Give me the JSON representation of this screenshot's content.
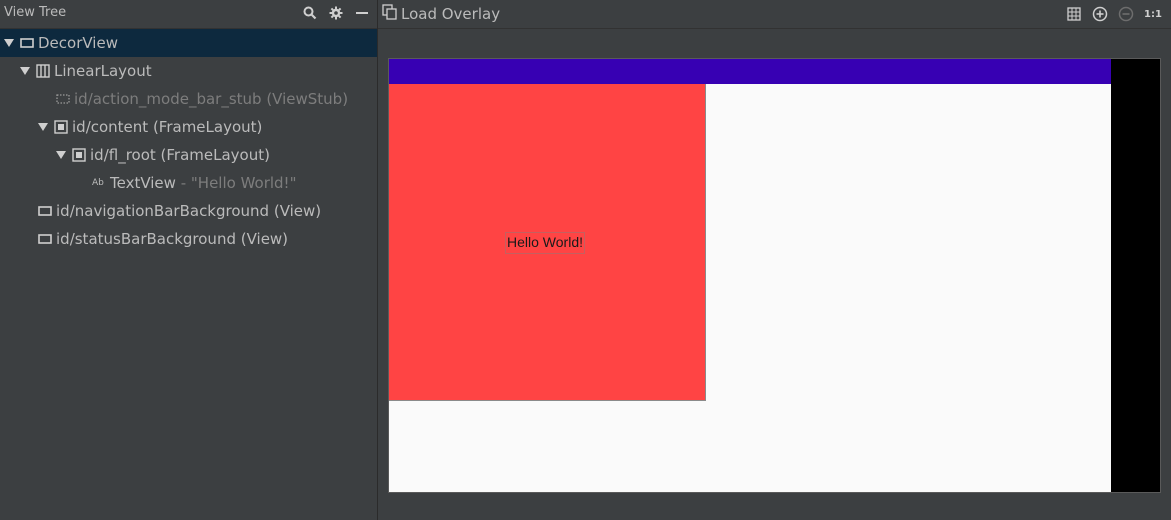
{
  "left_panel": {
    "title": "View Tree",
    "tree": [
      {
        "label": "DecorView",
        "suffix": ""
      },
      {
        "label": "LinearLayout",
        "suffix": ""
      },
      {
        "label": "id/action_mode_bar_stub (ViewStub)",
        "suffix": ""
      },
      {
        "label": "id/content (FrameLayout)",
        "suffix": ""
      },
      {
        "label": "id/fl_root (FrameLayout)",
        "suffix": ""
      },
      {
        "label": "TextView",
        "suffix": " - \"Hello World!\""
      },
      {
        "label": "id/navigationBarBackground (View)",
        "suffix": ""
      },
      {
        "label": "id/statusBarBackground (View)",
        "suffix": ""
      }
    ],
    "ab_badge": "Ab"
  },
  "right_panel": {
    "load_overlay_label": "Load Overlay",
    "zoom_actual_label": "1:1"
  },
  "preview": {
    "text_view": "Hello World!"
  },
  "colors": {
    "status_bar": "#3700b3",
    "fl_root": "#ff4444",
    "nav_bar": "#000000",
    "selection": "#0d293e"
  }
}
